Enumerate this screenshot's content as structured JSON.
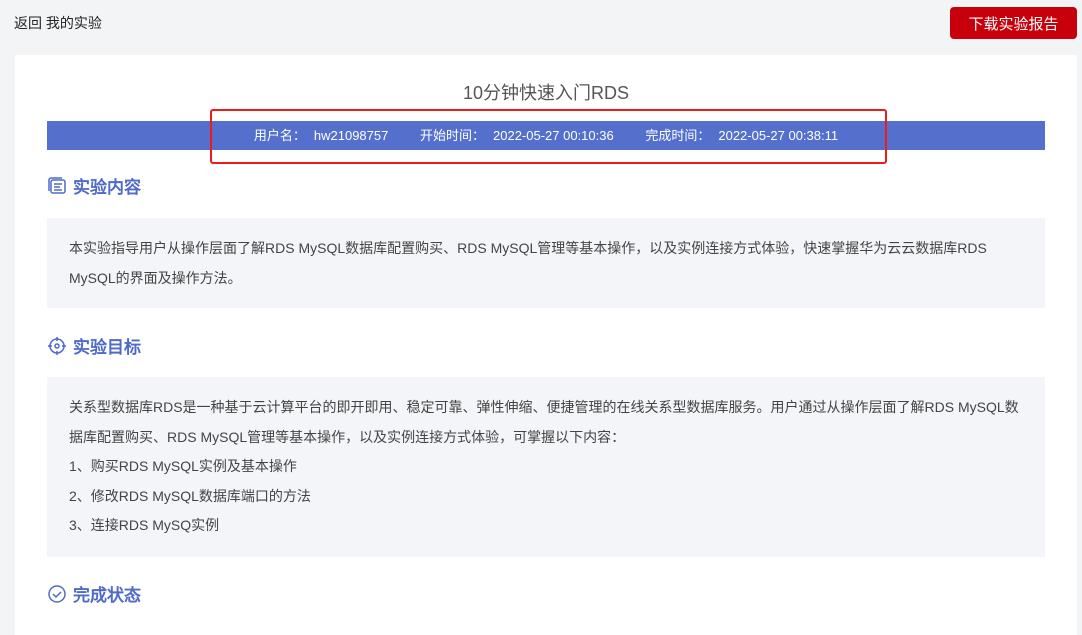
{
  "nav": {
    "back": "返回",
    "my_labs": "我的实验"
  },
  "download_button": "下载实验报告",
  "title": "10分钟快速入门RDS",
  "info": {
    "username_label": "用户名：",
    "username": "hw21098757",
    "start_label": "开始时间：",
    "start": "2022-05-27 00:10:36",
    "end_label": "完成时间：",
    "end": "2022-05-27 00:38:11"
  },
  "sections": {
    "content": {
      "title": "实验内容",
      "text": "本实验指导用户从操作层面了解RDS MySQL数据库配置购买、RDS MySQL管理等基本操作，以及实例连接方式体验，快速掌握华为云云数据库RDS MySQL的界面及操作方法。"
    },
    "goals": {
      "title": "实验目标",
      "intro": "关系型数据库RDS是一种基于云计算平台的即开即用、稳定可靠、弹性伸缩、便捷管理的在线关系型数据库服务。用户通过从操作层面了解RDS MySQL数据库配置购买、RDS MySQL管理等基本操作，以及实例连接方式体验，可掌握以下内容：",
      "items": [
        "1、购买RDS MySQL实例及基本操作",
        "2、修改RDS MySQL数据库端口的方法",
        "3、连接RDS MySQ实例"
      ]
    },
    "status": {
      "title": "完成状态"
    }
  },
  "colors": {
    "accent": "#5470cc",
    "button": "#c7000b",
    "highlight": "#f01a1a"
  }
}
